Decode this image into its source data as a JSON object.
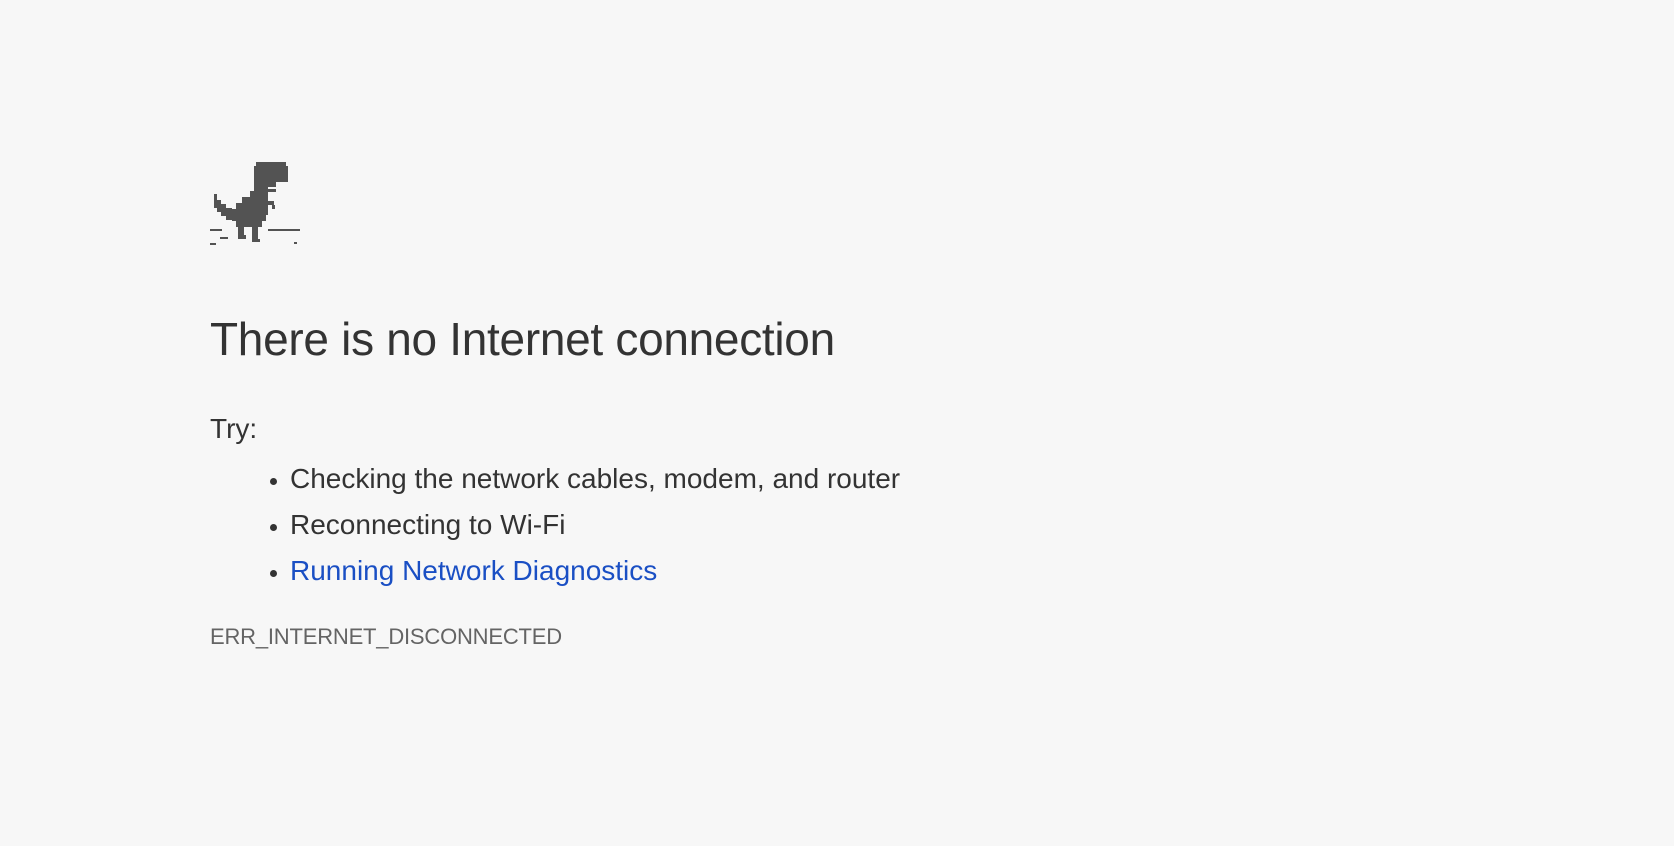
{
  "page": {
    "background_color": "#f7f7f7",
    "dino_icon": "t-rex-dino-icon",
    "dino_color": "#535353",
    "title": "There is no Internet connection",
    "try_label": "Try:",
    "suggestions": [
      {
        "text": "Checking the network cables, modem, and router",
        "is_link": false
      },
      {
        "text": "Reconnecting to Wi-Fi",
        "is_link": false
      },
      {
        "text": "Running Network Diagnostics",
        "is_link": true,
        "link_color": "#1a4fc4"
      }
    ],
    "error_code": "ERR_INTERNET_DISCONNECTED"
  }
}
